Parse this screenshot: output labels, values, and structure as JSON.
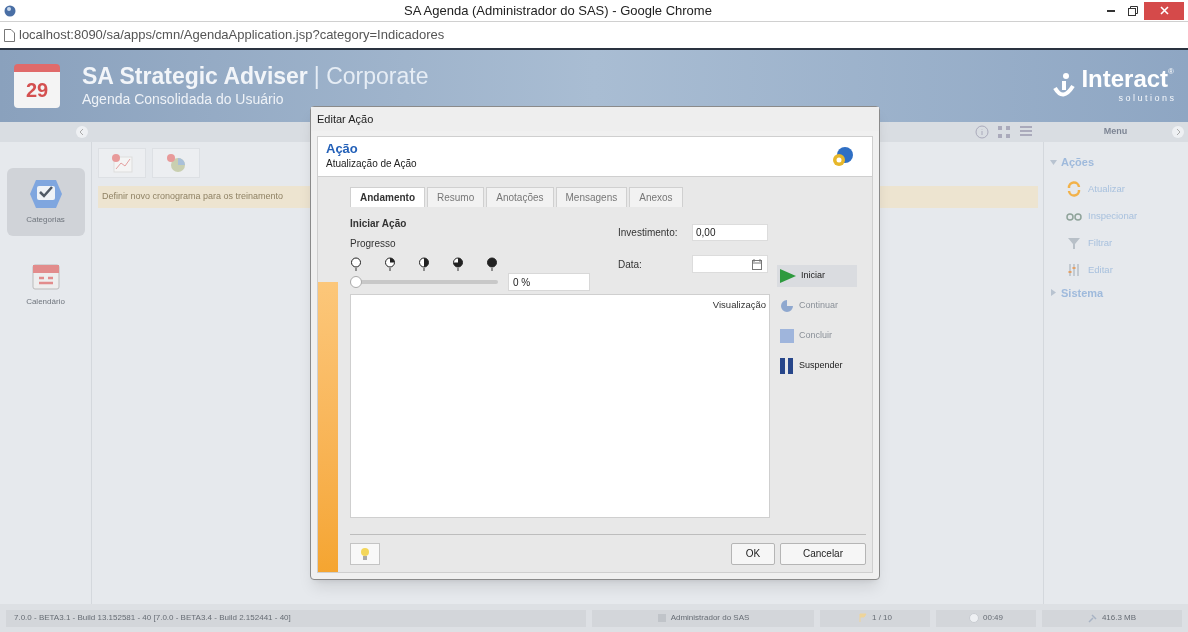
{
  "browser": {
    "title": "SA Agenda (Administrador do SAS) - Google Chrome",
    "url": "localhost:8090/sa/apps/cmn/AgendaApplication.jsp?category=Indicadores"
  },
  "header": {
    "title": "SA Strategic Adviser",
    "edition": "| Corporate",
    "subtitle": "Agenda Consolidada do Usuário",
    "logo_text": "Interact",
    "logo_sub": "s o l u t i o n s",
    "logo_mark": "®",
    "calendar_day": "29"
  },
  "toolbar": {
    "menu_label": "Menu"
  },
  "sidebar": {
    "items": [
      {
        "label": "Categorias",
        "kind": "categories",
        "selected": true
      },
      {
        "label": "Calendário",
        "kind": "calendar",
        "selected": false
      }
    ]
  },
  "main": {
    "notice": "Definir novo cronograma para os treinamento"
  },
  "menu": {
    "groups": [
      {
        "label": "Ações",
        "expanded": true,
        "children": [
          {
            "label": "Atualizar",
            "kind": "refresh"
          },
          {
            "label": "Inspecionar",
            "kind": "inspect"
          },
          {
            "label": "Filtrar",
            "kind": "filter"
          },
          {
            "label": "Editar",
            "kind": "edit"
          }
        ]
      },
      {
        "label": "Sistema",
        "expanded": false
      }
    ]
  },
  "dialog": {
    "title": "Editar Ação",
    "heading": "Ação",
    "subheading": "Atualização de Ação",
    "tabs": [
      {
        "label": "Andamento",
        "selected": true
      },
      {
        "label": "Resumo",
        "selected": false
      },
      {
        "label": "Anotações",
        "selected": false
      },
      {
        "label": "Mensagens",
        "selected": false
      },
      {
        "label": "Anexos",
        "selected": false
      }
    ],
    "section": "Iniciar Ação",
    "progress_label": "Progresso",
    "progress": {
      "level": 0
    },
    "progress_value": "0 %",
    "investment_label": "Investimento:",
    "investment_value": "0,00",
    "date_label": "Data:",
    "preview_label": "Visualização",
    "actions": [
      {
        "label": "Iniciar",
        "kind": "start",
        "disabled": false,
        "highlighted": true
      },
      {
        "label": "Continuar",
        "kind": "continue",
        "disabled": true,
        "highlighted": false
      },
      {
        "label": "Concluir",
        "kind": "finish",
        "disabled": true,
        "highlighted": false
      },
      {
        "label": "Suspender",
        "kind": "suspend",
        "disabled": false,
        "highlighted": false
      }
    ],
    "buttons": [
      "OK",
      "Cancelar"
    ]
  },
  "status_bar": {
    "version": "7.0.0 - BETA3.1 - Build 13.152581 - 40 [7.0.0 - BETA3.4 - Build 2.152441 - 40]",
    "user": "Administrador do SAS",
    "count": "1 / 10",
    "time": "00:49",
    "memory": "416.3 MB"
  }
}
